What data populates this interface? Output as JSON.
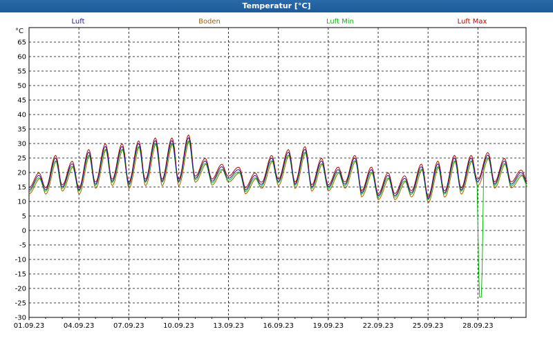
{
  "window": {
    "title": "Temperatur [°C]"
  },
  "chart_data": {
    "type": "line",
    "ylabel": "°C",
    "ylim": [
      -30,
      70
    ],
    "yticks": [
      65,
      60,
      55,
      50,
      45,
      40,
      35,
      30,
      25,
      20,
      15,
      10,
      5,
      0,
      -5,
      -10,
      -15,
      -20,
      -25,
      -30
    ],
    "x_start": "01.09.23",
    "xticks": [
      "01.09.23",
      "04.09.23",
      "07.09.23",
      "10.09.23",
      "13.09.23",
      "16.09.23",
      "19.09.23",
      "22.09.23",
      "25.09.23",
      "28.09.23"
    ],
    "grid": true,
    "legend_placement": "top",
    "colors": {
      "luft": "#1a1aa0",
      "boden": "#b05a00",
      "luft_min": "#00c000",
      "luft_max": "#c00000"
    },
    "series": [
      {
        "name": "Luft"
      },
      {
        "name": "Boden"
      },
      {
        "name": "Luft Min"
      },
      {
        "name": "Luft Max"
      }
    ],
    "daily_low": [
      14,
      14,
      15,
      14,
      16,
      17,
      16,
      17,
      17,
      17,
      18,
      17,
      18,
      14,
      16,
      17,
      16,
      15,
      15,
      16,
      13,
      12,
      12,
      13,
      11,
      13,
      14,
      17,
      16,
      16
    ],
    "daily_high": [
      19,
      25,
      23,
      27,
      29,
      29,
      30,
      31,
      31,
      32,
      24,
      22,
      21,
      19,
      25,
      27,
      28,
      24,
      21,
      25,
      21,
      19,
      18,
      22,
      23,
      25,
      25,
      26,
      24,
      20
    ],
    "spike": {
      "day": 27.15,
      "min": -23
    }
  }
}
